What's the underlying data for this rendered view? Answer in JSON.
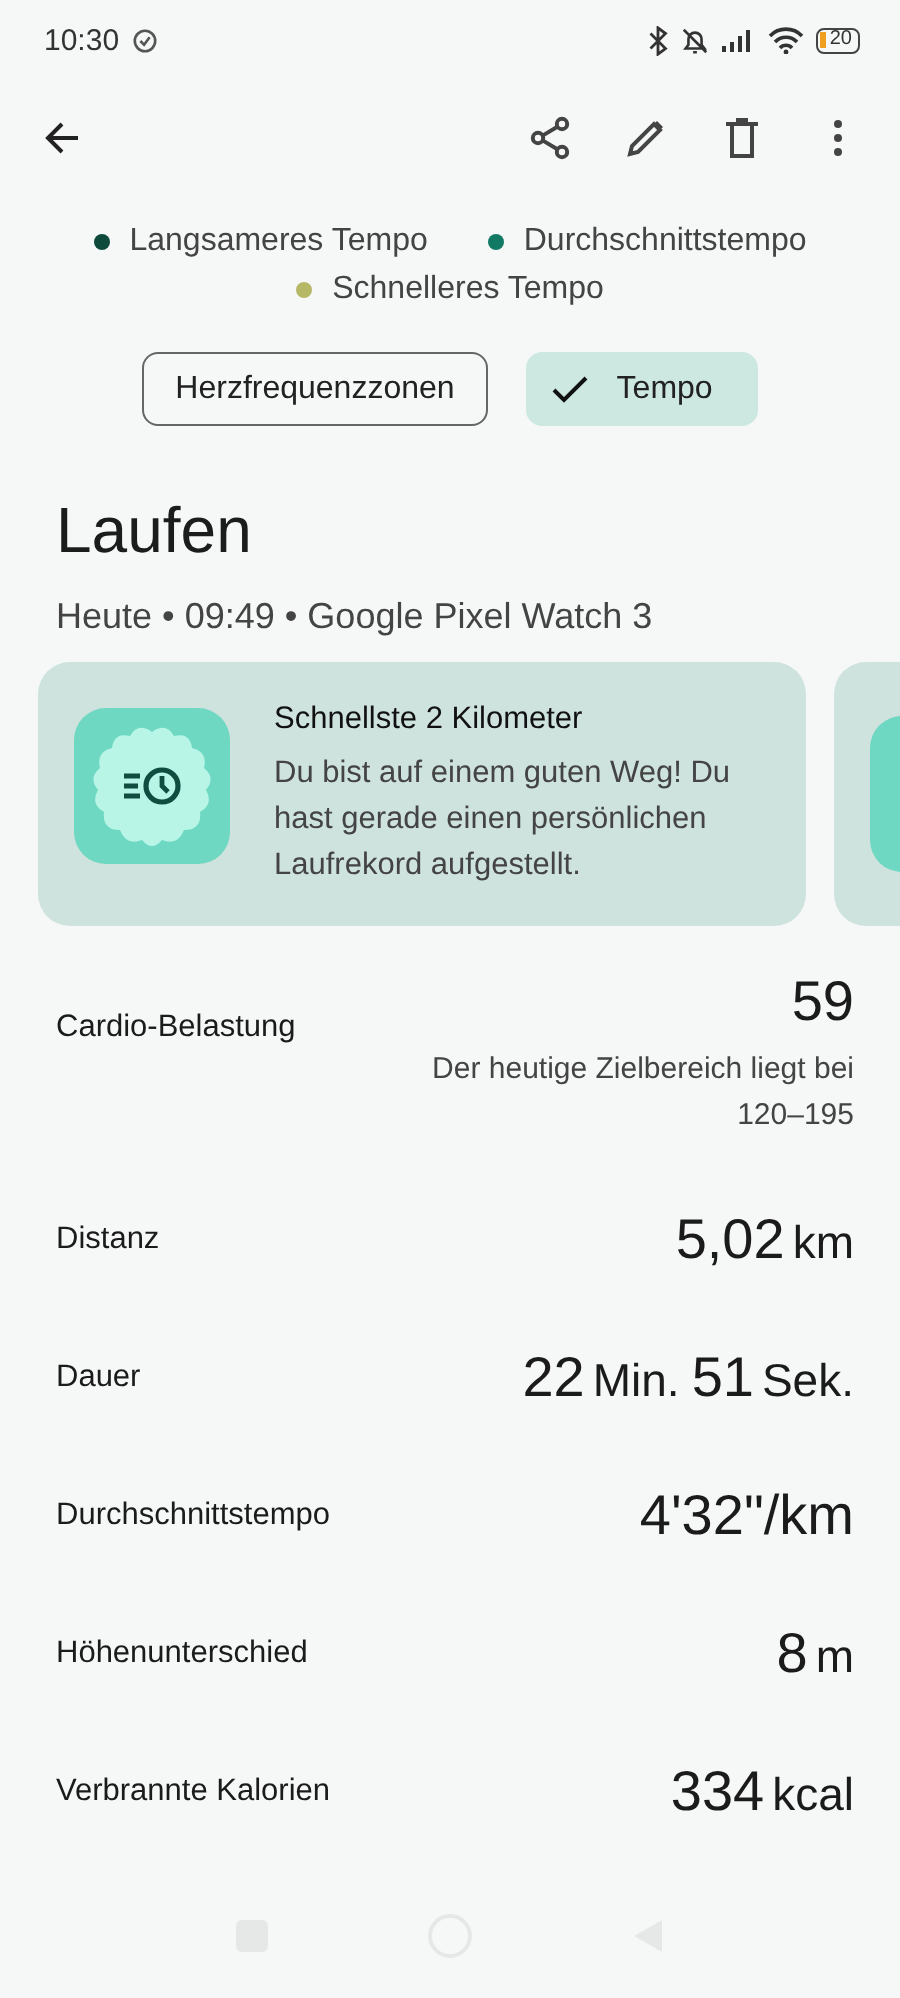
{
  "status_bar": {
    "time": "10:30",
    "battery": "20"
  },
  "legend": [
    {
      "label": "Langsameres Tempo",
      "color": "#0d4a3c"
    },
    {
      "label": "Durchschnittstempo",
      "color": "#127a64"
    },
    {
      "label": "Schnelleres Tempo",
      "color": "#b7b866"
    }
  ],
  "chips": [
    {
      "label": "Herzfrequenzzonen",
      "selected": false
    },
    {
      "label": "Tempo",
      "selected": true
    }
  ],
  "activity": {
    "title": "Laufen",
    "subtitle": "Heute • 09:49 • Google Pixel Watch 3"
  },
  "achievement": {
    "title": "Schnellste 2 Kilometer",
    "text": "Du bist auf einem guten Weg! Du hast gerade einen persönlichen Laufrekord aufgestellt."
  },
  "stats": [
    {
      "label": "Cardio-Belastung",
      "value": [
        {
          "kind": "number",
          "text": "59"
        }
      ],
      "note": "Der heutige Zielbereich liegt bei 120–195"
    },
    {
      "label": "Distanz",
      "value": [
        {
          "kind": "number",
          "text": "5,02"
        },
        {
          "kind": "unit",
          "text": "km"
        }
      ]
    },
    {
      "label": "Dauer",
      "value": [
        {
          "kind": "number",
          "text": "22"
        },
        {
          "kind": "unit",
          "text": "Min."
        },
        {
          "kind": "number",
          "text": "51"
        },
        {
          "kind": "unit",
          "text": "Sek."
        }
      ]
    },
    {
      "label": "Durchschnittstempo",
      "value": [
        {
          "kind": "number",
          "text": "4'32\"/km"
        }
      ]
    },
    {
      "label": "Höhenunterschied",
      "value": [
        {
          "kind": "number",
          "text": "8"
        },
        {
          "kind": "unit",
          "text": "m"
        }
      ]
    },
    {
      "label": "Verbrannte Kalorien",
      "value": [
        {
          "kind": "number",
          "text": "334"
        },
        {
          "kind": "unit",
          "text": "kcal"
        }
      ]
    }
  ]
}
